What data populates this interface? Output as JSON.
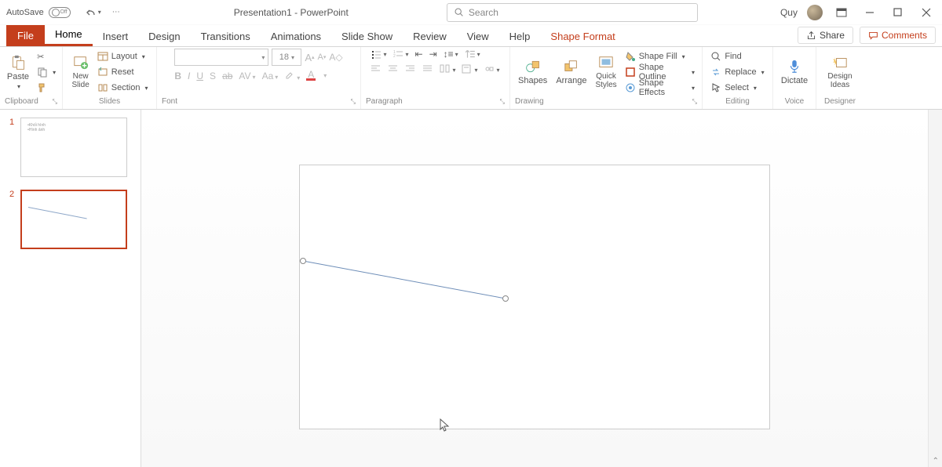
{
  "titlebar": {
    "autosave_label": "AutoSave",
    "autosave_state": "Off",
    "doc_title": "Presentation1 - PowerPoint",
    "search_placeholder": "Search",
    "username": "Quy"
  },
  "tabs": {
    "file": "File",
    "home": "Home",
    "insert": "Insert",
    "design": "Design",
    "transitions": "Transitions",
    "animations": "Animations",
    "slideshow": "Slide Show",
    "review": "Review",
    "view": "View",
    "help": "Help",
    "shape_format": "Shape Format",
    "share": "Share",
    "comments": "Comments"
  },
  "ribbon": {
    "clipboard": {
      "label": "Clipboard",
      "paste": "Paste"
    },
    "slides": {
      "label": "Slides",
      "new_slide": "New\nSlide",
      "layout": "Layout",
      "reset": "Reset",
      "section": "Section"
    },
    "font": {
      "label": "Font",
      "size": "18",
      "b": "B",
      "i": "I",
      "u": "U",
      "s": "S",
      "av": "AV",
      "aa": "Aa",
      "ab": "ab"
    },
    "paragraph": {
      "label": "Paragraph"
    },
    "drawing": {
      "label": "Drawing",
      "shapes": "Shapes",
      "arrange": "Arrange",
      "quick_styles": "Quick\nStyles",
      "shape_fill": "Shape Fill",
      "shape_outline": "Shape Outline",
      "shape_effects": "Shape Effects"
    },
    "editing": {
      "label": "Editing",
      "find": "Find",
      "replace": "Replace",
      "select": "Select"
    },
    "voice": {
      "label": "Voice",
      "dictate": "Dictate"
    },
    "designer": {
      "label": "Designer",
      "design_ideas": "Design\nIdeas"
    }
  },
  "thumbnails": {
    "slide1_num": "1",
    "slide1_line1": "•Khối hình",
    "slide1_line2": "•Hình ảnh",
    "slide2_num": "2"
  }
}
